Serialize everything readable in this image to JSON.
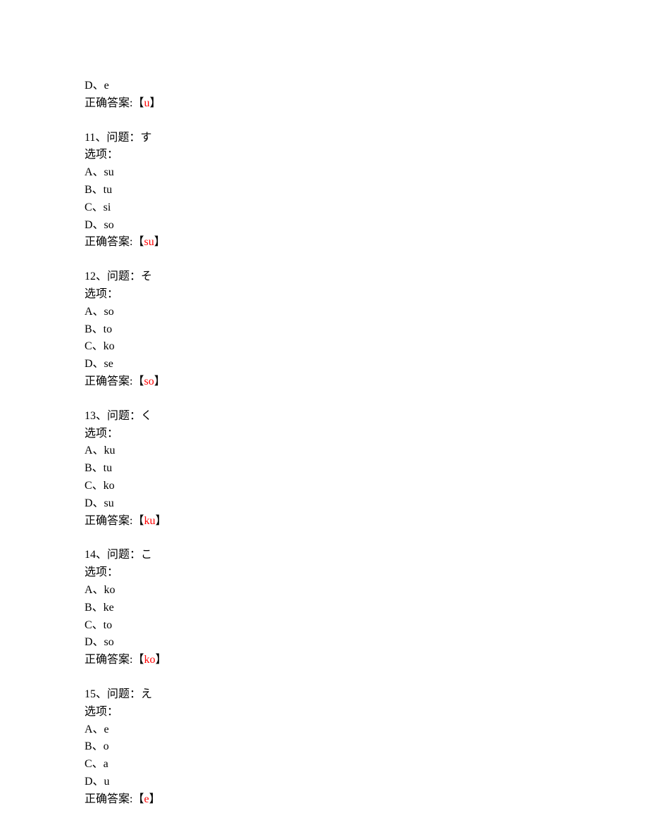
{
  "labels": {
    "question_prefix": "问题：",
    "options_label": "选项：",
    "answer_label": "正确答案:",
    "bracket_open": "【",
    "bracket_close": "】",
    "option_sep": "、",
    "number_sep": "、"
  },
  "partial_block": {
    "option_letter": "D",
    "option_value": "e",
    "answer": "u"
  },
  "questions": [
    {
      "number": "11",
      "prompt": "す",
      "options": [
        {
          "letter": "A",
          "value": "su"
        },
        {
          "letter": "B",
          "value": "tu"
        },
        {
          "letter": "C",
          "value": "si"
        },
        {
          "letter": "D",
          "value": "so"
        }
      ],
      "answer": "su"
    },
    {
      "number": "12",
      "prompt": "そ",
      "options": [
        {
          "letter": "A",
          "value": "so"
        },
        {
          "letter": "B",
          "value": "to"
        },
        {
          "letter": "C",
          "value": "ko"
        },
        {
          "letter": "D",
          "value": "se"
        }
      ],
      "answer": "so"
    },
    {
      "number": "13",
      "prompt": "く",
      "options": [
        {
          "letter": "A",
          "value": "ku"
        },
        {
          "letter": "B",
          "value": "tu"
        },
        {
          "letter": "C",
          "value": "ko"
        },
        {
          "letter": "D",
          "value": "su"
        }
      ],
      "answer": "ku"
    },
    {
      "number": "14",
      "prompt": "こ",
      "options": [
        {
          "letter": "A",
          "value": "ko"
        },
        {
          "letter": "B",
          "value": "ke"
        },
        {
          "letter": "C",
          "value": "to"
        },
        {
          "letter": "D",
          "value": "so"
        }
      ],
      "answer": "ko"
    },
    {
      "number": "15",
      "prompt": "え",
      "options": [
        {
          "letter": "A",
          "value": "e"
        },
        {
          "letter": "B",
          "value": "o"
        },
        {
          "letter": "C",
          "value": "a"
        },
        {
          "letter": "D",
          "value": "u"
        }
      ],
      "answer": "e"
    }
  ]
}
